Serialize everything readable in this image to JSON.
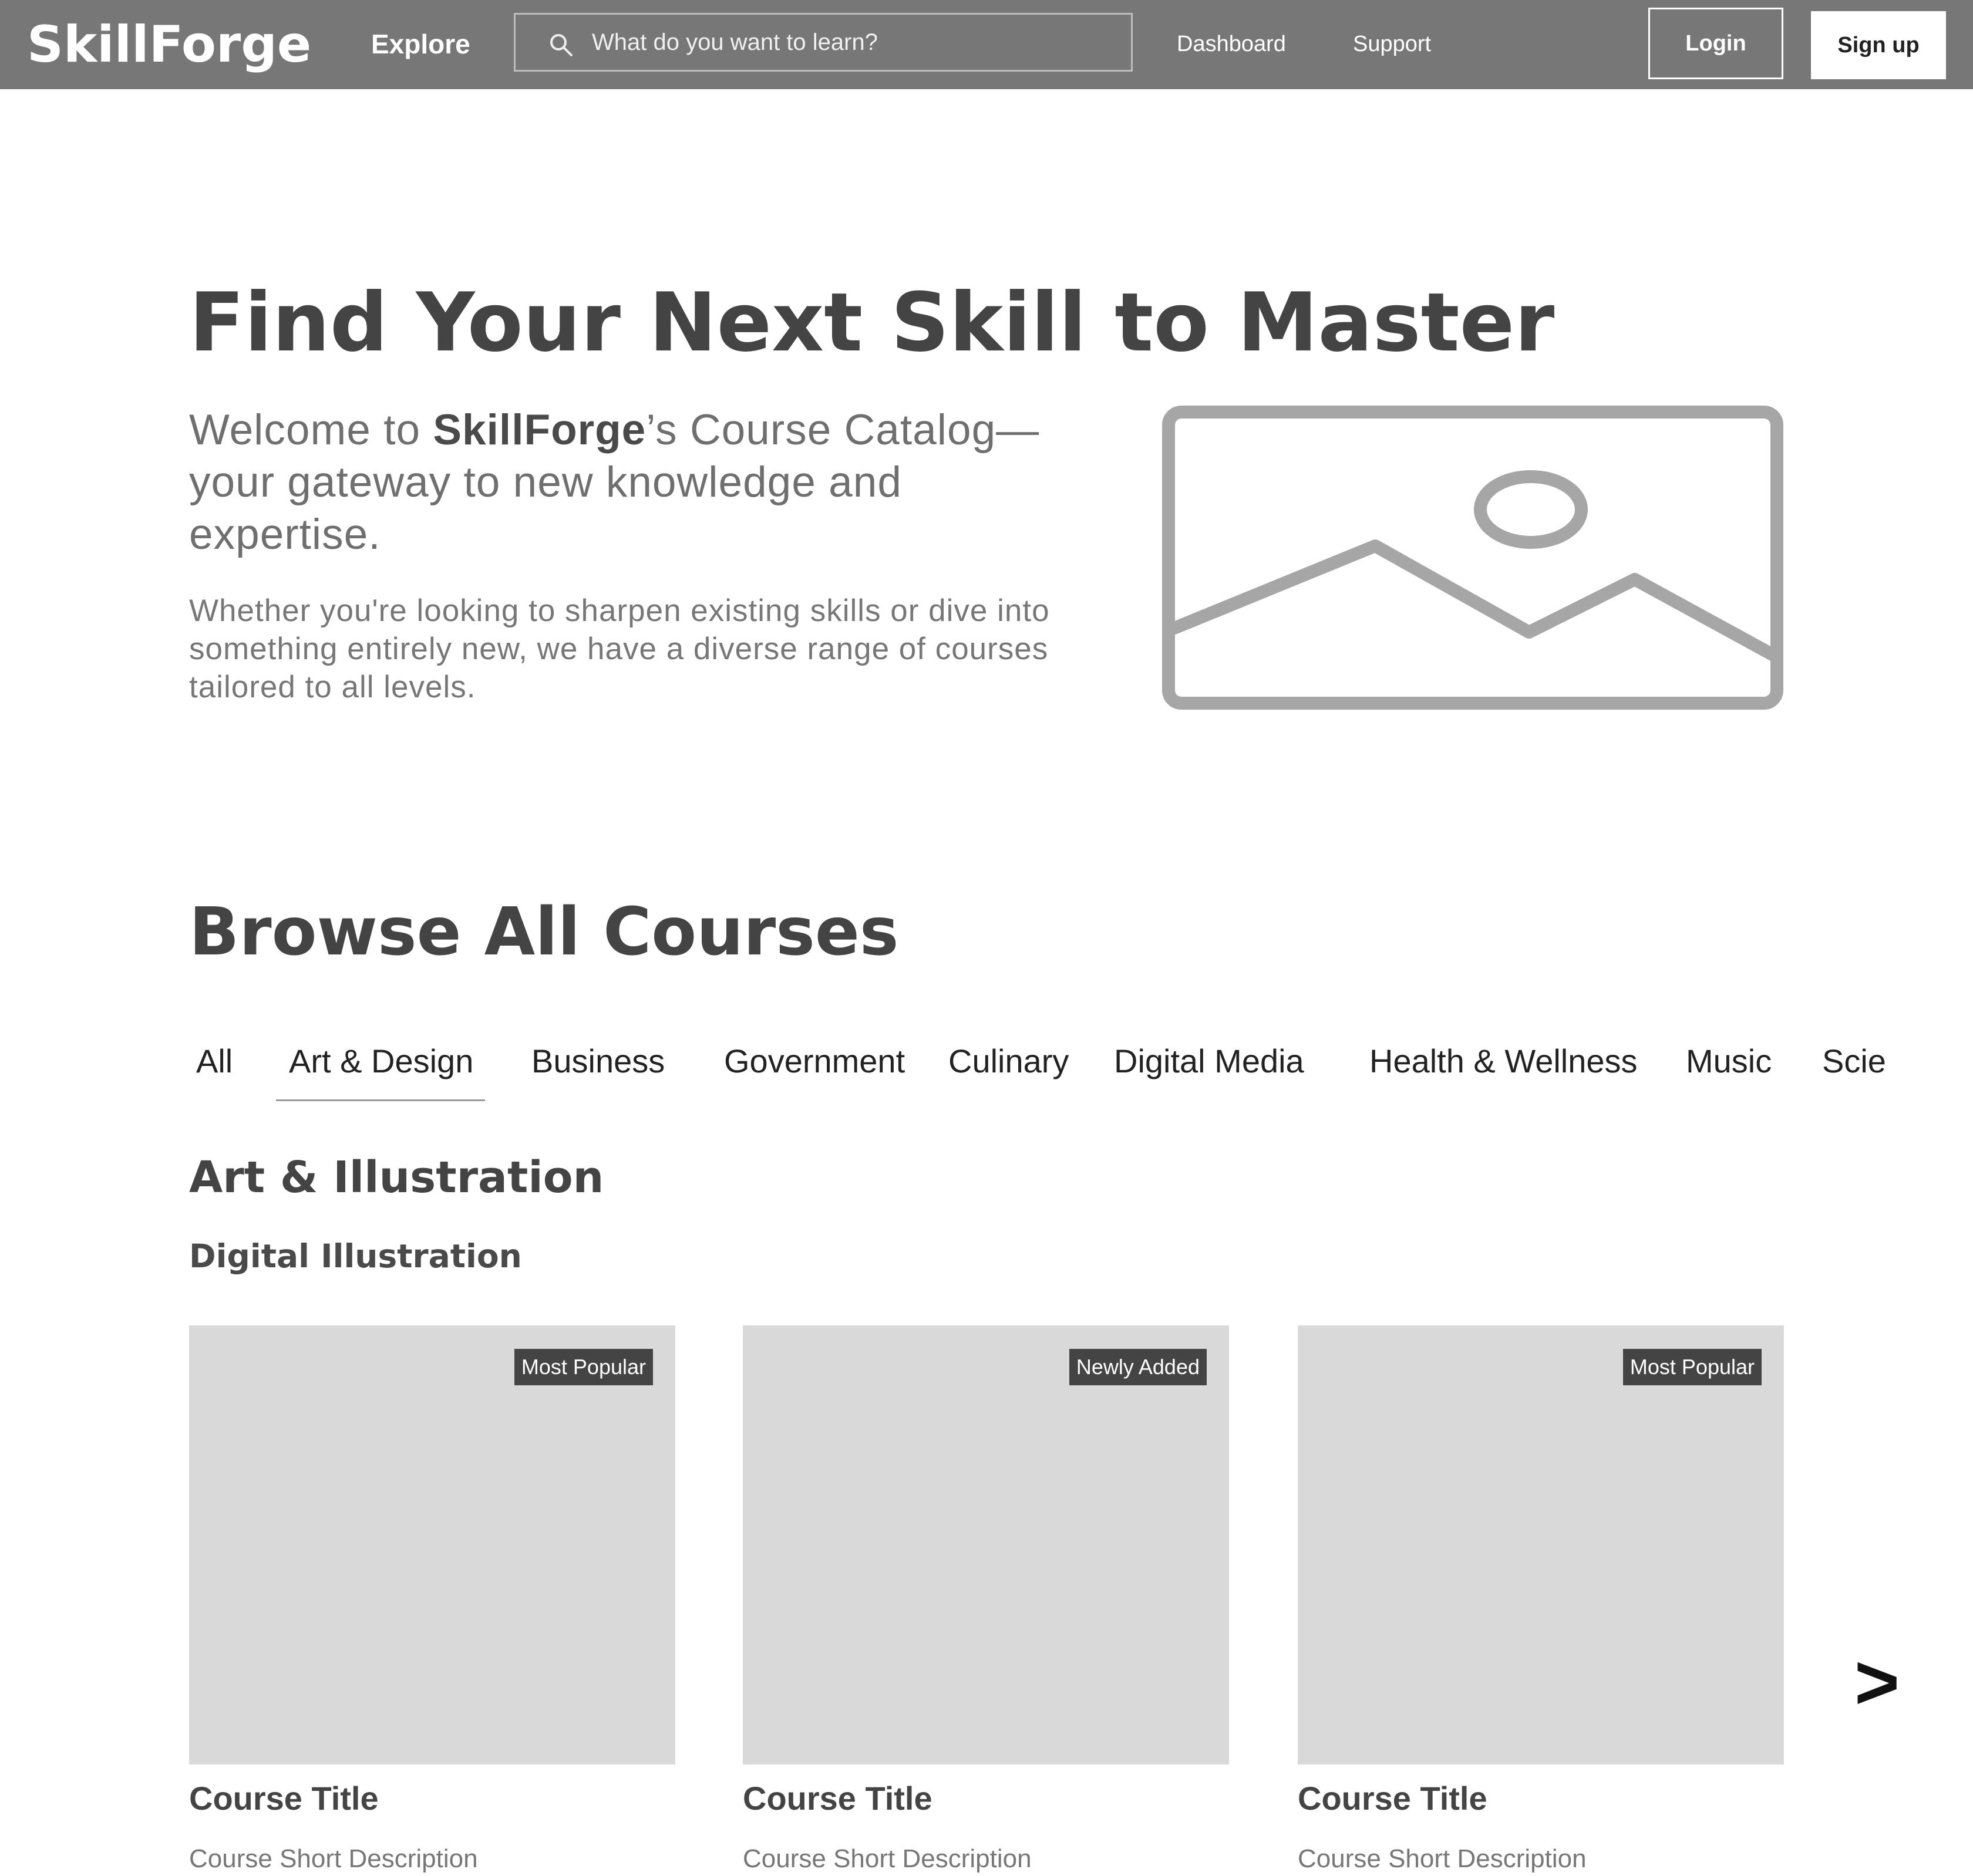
{
  "header": {
    "logo": "SkillForge",
    "explore_label": "Explore",
    "search_placeholder": "What do you want to learn?",
    "links": [
      "Dashboard",
      "Support"
    ],
    "login_label": "Login",
    "signup_label": "Sign up"
  },
  "hero": {
    "title": "Find Your Next Skill to Master",
    "intro_pre": "Welcome to ",
    "intro_brand": "SkillForge",
    "intro_post": "’s Course Catalog—your gateway to new knowledge and expertise.",
    "body": "Whether you're looking to sharpen existing skills or dive into something entirely new, we have a diverse range of courses tailored to all levels."
  },
  "browse": {
    "title": "Browse All Courses",
    "tabs": [
      "All",
      "Art & Design",
      "Business",
      "Government",
      "Culinary",
      "Digital Media",
      "Health & Wellness",
      "Music",
      "Scie"
    ],
    "active_tab": "Art & Design",
    "section_title": "Art & Illustration",
    "subsection_title": "Digital Illustration",
    "cards": [
      {
        "badge": "Most Popular",
        "title": "Course Title",
        "description": "Course Short Description"
      },
      {
        "badge": "Newly Added",
        "title": "Course Title",
        "description": "Course Short Description"
      },
      {
        "badge": "Most Popular",
        "title": "Course Title",
        "description": "Course Short Description"
      }
    ],
    "next_label": ">"
  },
  "colors": {
    "header_bg": "#777777",
    "card_placeholder": "#d9d9d9",
    "badge_bg": "#444444",
    "image_placeholder_stroke": "#a6a6a6"
  },
  "icons": {
    "search": "search-icon",
    "hero_image": "image-placeholder-icon",
    "next": "chevron-right-icon"
  }
}
